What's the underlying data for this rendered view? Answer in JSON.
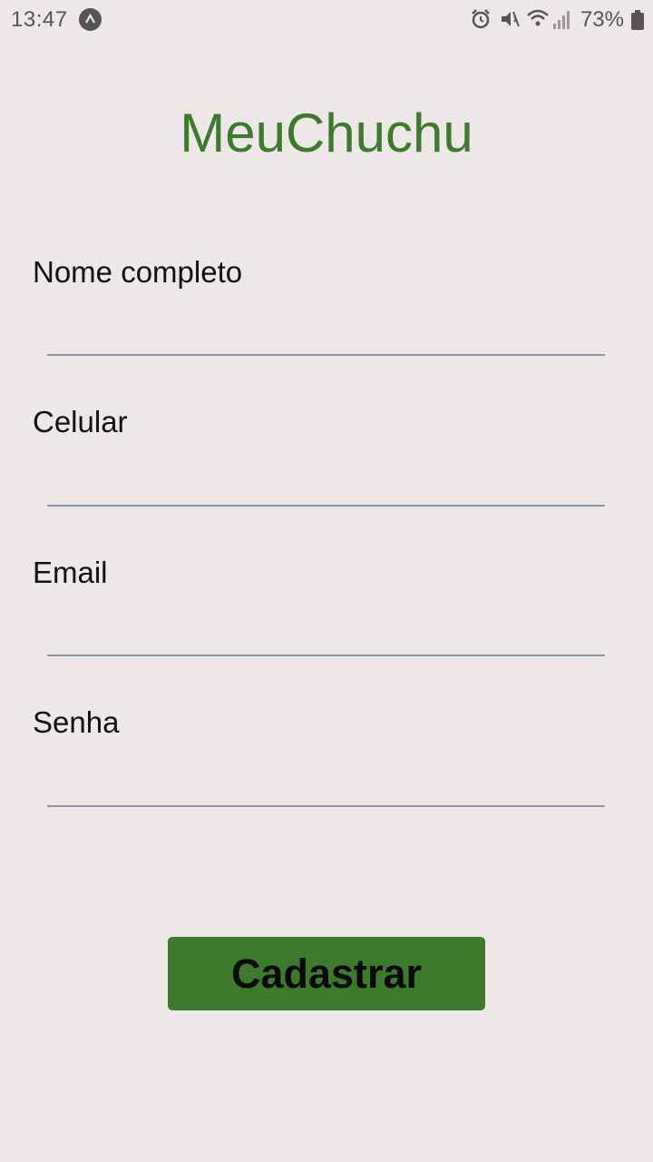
{
  "status_bar": {
    "time": "13:47",
    "battery": "73%",
    "icons": [
      "app-notification-icon",
      "alarm-icon",
      "mute-icon",
      "wifi-icon",
      "signal-icon",
      "battery-icon"
    ]
  },
  "app": {
    "title": "MeuChuchu",
    "title_color": "#3d7a2d",
    "background": "#ede7e7"
  },
  "form": {
    "fields": [
      {
        "label": "Nome completo",
        "value": "",
        "placeholder": ""
      },
      {
        "label": "Celular",
        "value": "",
        "placeholder": ""
      },
      {
        "label": "Email",
        "value": "",
        "placeholder": ""
      },
      {
        "label": "Senha",
        "value": "",
        "placeholder": ""
      }
    ],
    "submit_label": "Cadastrar",
    "submit_color": "#3d7a2d"
  }
}
